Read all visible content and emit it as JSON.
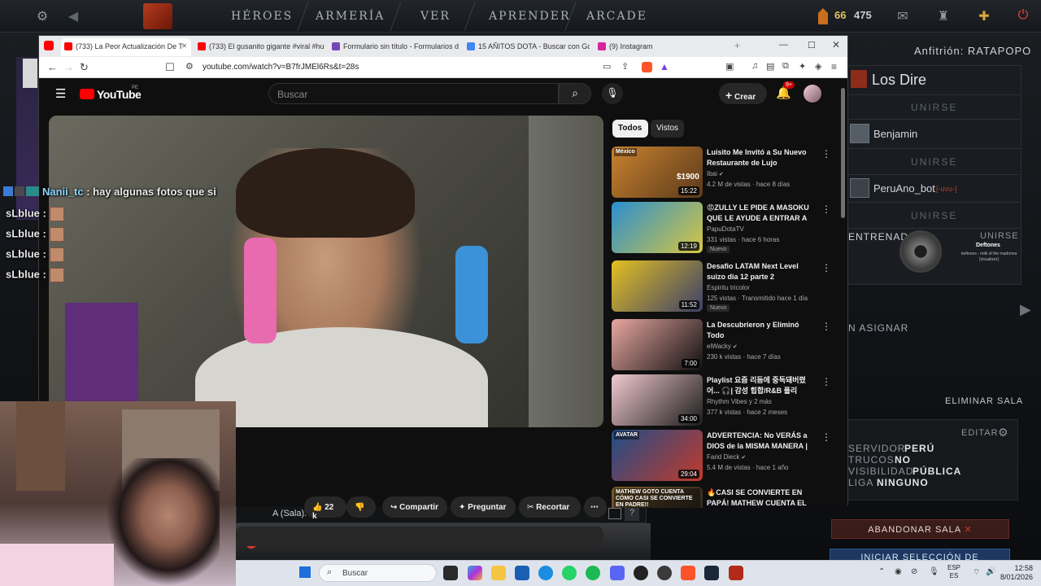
{
  "dota": {
    "nav": [
      "HÉROES",
      "ARMERÍA",
      "VER",
      "APRENDER",
      "ARCADE"
    ],
    "gold_a": "66",
    "gold_b": "475",
    "host": "Anfitrión: RATAPOPO",
    "team": "Los Dire",
    "join": "UNIRSE",
    "players": [
      {
        "name": "Benjamin",
        "tag": ""
      },
      {
        "name": "PeruAno_bot",
        "tag": "[-uvu-]"
      }
    ],
    "trainer": "ENTRENADO",
    "trainer_join": "UNIRSE",
    "assign": "N ASIGNAR",
    "delete_room": "ELIMINAR SALA",
    "edit": "EDITAR",
    "settings": [
      {
        "label": "SERVIDOR",
        "value": "PERÚ"
      },
      {
        "label": "TRUCOS",
        "value": "NO"
      },
      {
        "label": "VISIBILIDAD",
        "value": "PÚBLICA"
      },
      {
        "label": "LIGA",
        "value": "NINGUNO"
      }
    ],
    "abandon": "ABANDONAR SALA",
    "start": "INICIAR SELECCIÓN DE",
    "music_title": "Deftones",
    "music_sub": "deftones - milk of the madonna [visualizer]",
    "chat_prefix": "A (Sala):",
    "notif": "1"
  },
  "browser": {
    "tabs": [
      {
        "label": "(733) La Peor Actualización De T",
        "color": "#ff0000",
        "active": true
      },
      {
        "label": "(733) El gusanito gigante #viral #hum",
        "color": "#ff0000",
        "active": false
      },
      {
        "label": "Formulario sin título - Formularios de",
        "color": "#7248b9",
        "active": false
      },
      {
        "label": "15 AÑITOS DOTA - Buscar con Googl",
        "color": "#4285f4",
        "active": false
      },
      {
        "label": "(9) Instagram",
        "color": "#d6249f",
        "active": false
      }
    ],
    "url": "youtube.com/watch?v=B7frJMEl6Rs&t=28s"
  },
  "youtube": {
    "logo": "YouTube",
    "region": "PE",
    "search_placeholder": "Buscar",
    "create": "Crear",
    "notif_count": "9+",
    "chips": [
      "Todos",
      "Vistos"
    ],
    "actions": {
      "likes": "22 k",
      "share": "Compartir",
      "ask": "Preguntar",
      "clip": "Recortar"
    },
    "recs": [
      {
        "title": "Luisito Me Invitó a Su Nuevo Restaurante de Lujo",
        "channel": "Ibai",
        "verified": true,
        "meta": "4.2 M de vistas · hace 8 días",
        "duration": "15:22",
        "badge": "",
        "thumb_badge": "México",
        "price": "$1900",
        "c1": "#c9822e",
        "c2": "#5a3a1c"
      },
      {
        "title": "😡ZULLY LE PIDE A MASOKU QUE LE AYUDE A ENTRAR A L...",
        "channel": "PapuDotaTV",
        "verified": false,
        "meta": "331 vistas · hace 6 horas",
        "duration": "12:19",
        "badge": "Nuevo",
        "thumb_badge": "",
        "price": "",
        "c1": "#2a8fd0",
        "c2": "#d7c640"
      },
      {
        "title": "Desafio LATAM Next Level suizo dia 12 parte 2",
        "channel": "Espiritu tricolor",
        "verified": false,
        "meta": "125 vistas · Transmitido hace 1 día",
        "duration": "11:52",
        "badge": "Nuevo",
        "thumb_badge": "",
        "price": "",
        "c1": "#e3c021",
        "c2": "#3b3f6a"
      },
      {
        "title": "La Descubrieron y Eliminó Todo",
        "channel": "elWacky",
        "verified": true,
        "meta": "230 k vistas · hace 7 días",
        "duration": "7:00",
        "badge": "",
        "thumb_badge": "",
        "price": "",
        "c1": "#e8a7a0",
        "c2": "#101010"
      },
      {
        "title": "Playlist 요즘 리듬에 중독돼버렸어... 🎧| 감성 힙합/R&B 플리",
        "channel": "Rhythm Vibes y 2 más",
        "verified": false,
        "meta": "377 k vistas · hace 2 meses",
        "duration": "34:00",
        "badge": "",
        "thumb_badge": "",
        "price": "",
        "c1": "#f1c9cf",
        "c2": "#1b1b1b"
      },
      {
        "title": "ADVERTENCIA: No VERÁS a DIOS de la MISMA MANERA | ...",
        "channel": "Farid Dieck",
        "verified": true,
        "meta": "5.4 M de vistas · hace 1 año",
        "duration": "29:04",
        "badge": "",
        "thumb_badge": "AVATAR",
        "price": "",
        "c1": "#1f4d8a",
        "c2": "#c23a2a"
      },
      {
        "title": "🔥CASI SE CONVIERTE EN PAPÁ! MATHEW CUENTA EL",
        "channel": "",
        "verified": false,
        "meta": "",
        "duration": "",
        "badge": "",
        "thumb_badge": "MATHEW GOTO CUENTA CÓMO CASI SE CONVIERTE EN PADRE!!",
        "price": "",
        "c1": "#7a5a2a",
        "c2": "#1d1d1d"
      }
    ]
  },
  "chat": [
    {
      "user": "Nanii_tc",
      "text": ": hay algunas fotos que si",
      "color": "#8ad6ff",
      "emote": false
    },
    {
      "user": "sLblue",
      "text": ":",
      "color": "#e8e8e8",
      "emote": true
    },
    {
      "user": "sLblue",
      "text": ":",
      "color": "#e8e8e8",
      "emote": true
    },
    {
      "user": "sLblue",
      "text": ":",
      "color": "#e8e8e8",
      "emote": true
    },
    {
      "user": "sLblue",
      "text": ":",
      "color": "#e8e8e8",
      "emote": true
    }
  ],
  "taskbar": {
    "search": "Buscar",
    "lang_a": "ESP",
    "lang_b": "ES",
    "time": "12:58",
    "date": "8/01/2026"
  }
}
